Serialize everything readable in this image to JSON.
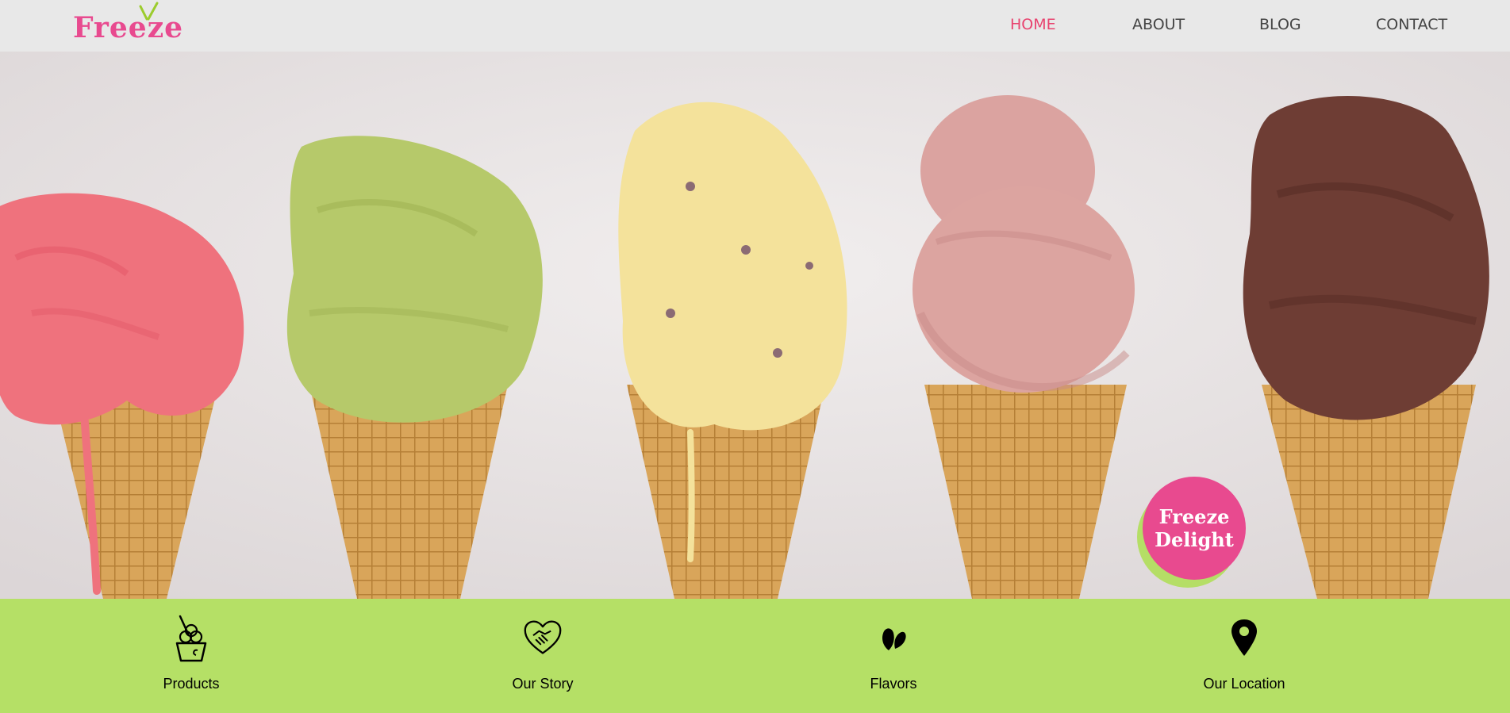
{
  "brand": {
    "logo_text": "Freeze"
  },
  "nav": {
    "items": [
      {
        "label": "HOME",
        "active": true
      },
      {
        "label": "ABOUT",
        "active": false
      },
      {
        "label": "BLOG",
        "active": false
      },
      {
        "label": "CONTACT",
        "active": false
      }
    ],
    "active_color": "#e8436f",
    "text_color": "#444444"
  },
  "hero": {
    "subject": "five ice cream cones (strawberry, pistachio, vanilla chip, raspberry, chocolate)"
  },
  "badge": {
    "line1": "Freeze",
    "line2": "Delight"
  },
  "features": [
    {
      "label": "Products",
      "icon": "ice-cream-cup-icon"
    },
    {
      "label": "Our Story",
      "icon": "heart-handshake-icon"
    },
    {
      "label": "Flavors",
      "icon": "leaf-icon"
    },
    {
      "label": "Our Location",
      "icon": "map-pin-icon"
    }
  ],
  "colors": {
    "brand_pink": "#e84a8f",
    "lime_green": "#b5e066",
    "nav_bg": "#e8e8e8"
  }
}
